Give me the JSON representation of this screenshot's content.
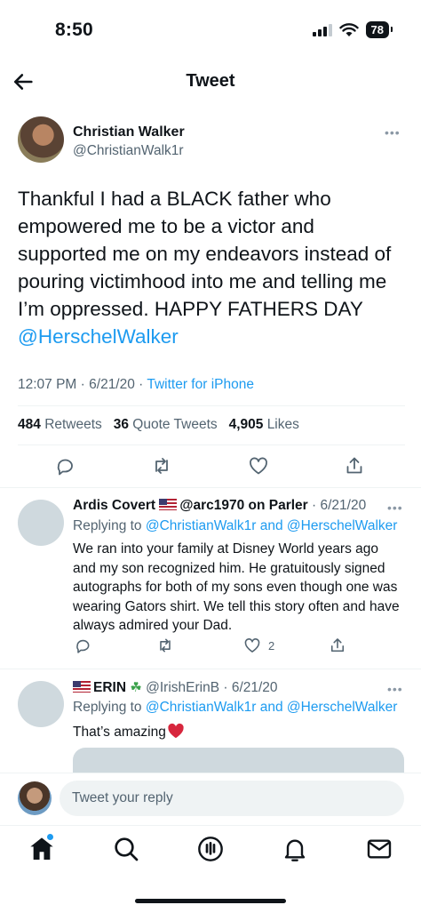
{
  "status_bar": {
    "time": "8:50",
    "battery": "78"
  },
  "header": {
    "title": "Tweet"
  },
  "tweet": {
    "author_name": "Christian Walker",
    "author_handle": "@ChristianWalk1r",
    "text": "Thankful I had a BLACK father who empowered me to be a victor and supported me on my endeavors instead of pouring victimhood into me and telling me I’m oppressed. HAPPY FATHERS DAY",
    "mention": "@HerschelWalker",
    "time": "12:07 PM",
    "date": "6/21/20",
    "source": "Twitter for iPhone",
    "retweets_count": "484",
    "retweets_label": "Retweets",
    "quotes_count": "36",
    "quotes_label": "Quote Tweets",
    "likes_count": "4,905",
    "likes_label": "Likes"
  },
  "replies": [
    {
      "name": "Ardis Covert",
      "handle": "@arc1970 on Parler",
      "date": "6/21/20",
      "replying_prefix": "Replying to",
      "replying_to_1": "@ChristianWalk1r",
      "replying_and": "and",
      "replying_to_2": "@HerschelWalker",
      "text": "We ran into your family at Disney World years ago and my son recognized him. He gratuitously signed autographs for both of my sons even though one was wearing Gators shirt. We tell this story often and have always admired your Dad.",
      "likes": "2"
    },
    {
      "name": "ERIN",
      "handle": "@IrishErinB",
      "date": "6/21/20",
      "replying_prefix": "Replying to",
      "replying_to_1": "@ChristianWalk1r",
      "replying_and": "and",
      "replying_to_2": "@HerschelWalker",
      "text": "That’s amazing"
    }
  ],
  "composer": {
    "placeholder": "Tweet your reply"
  },
  "colors": {
    "accent": "#1d9bf0",
    "text": "#0f1419",
    "secondary": "#536471",
    "divider": "#eff3f4"
  },
  "icons": [
    "back-arrow-icon",
    "more-icon",
    "reply-icon",
    "retweet-icon",
    "like-icon",
    "share-icon",
    "home-icon",
    "search-icon",
    "spaces-icon",
    "notifications-icon",
    "messages-icon"
  ]
}
